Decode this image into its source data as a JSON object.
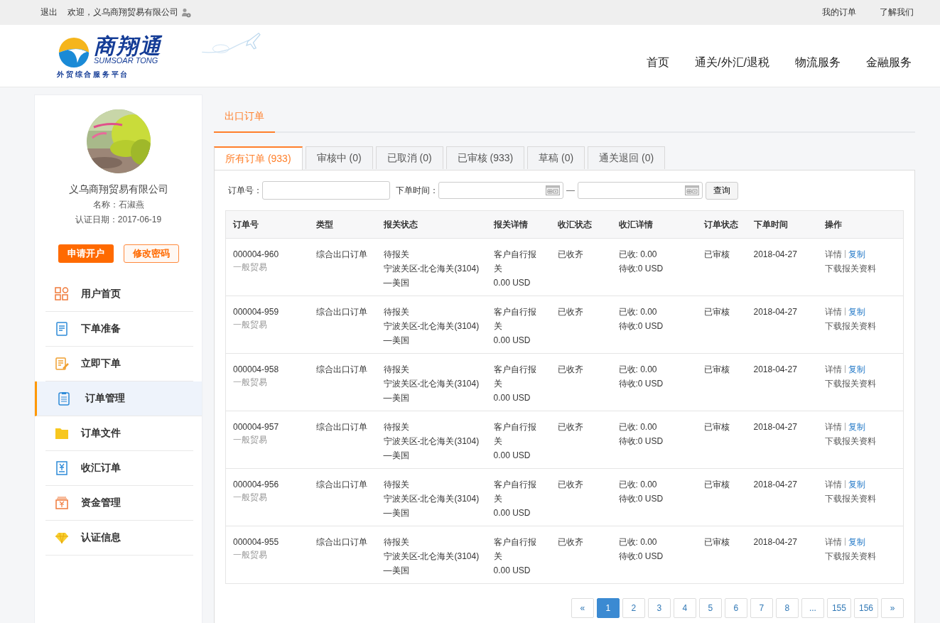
{
  "top_bar": {
    "logout": "退出",
    "welcome": "欢迎，义乌商翔贸易有限公司",
    "links": [
      "我的订单",
      "了解我们"
    ]
  },
  "header": {
    "logo": {
      "name": "商翔通",
      "latin": "SUMSOAR TONG",
      "tagline": "外 贸 综 合 服 务 平 台"
    },
    "nav": [
      "首页",
      "通关/外汇/退税",
      "物流服务",
      "金融服务"
    ]
  },
  "profile": {
    "company": "义乌商翔贸易有限公司",
    "contact": "名称：石淑燕",
    "cert_date": "认证日期：2017-06-19",
    "buttons": [
      "申请开户",
      "修改密码"
    ]
  },
  "sidebar": {
    "items": [
      {
        "label": "用户首页",
        "kind": "grid",
        "selected": false
      },
      {
        "label": "下单准备",
        "kind": "doc",
        "selected": false
      },
      {
        "label": "立即下单",
        "kind": "edit",
        "selected": false
      },
      {
        "label": "订单管理",
        "kind": "clipboard",
        "selected": true
      },
      {
        "label": "订单文件",
        "kind": "folder",
        "selected": false
      },
      {
        "label": "收汇订单",
        "kind": "receipt",
        "selected": false
      },
      {
        "label": "资金管理",
        "kind": "money",
        "selected": false
      },
      {
        "label": "认证信息",
        "kind": "diamond",
        "selected": false
      }
    ]
  },
  "page_tab": "出口订单",
  "tabs": [
    {
      "label": "所有订单 (933)",
      "selected": true
    },
    {
      "label": "审核中 (0)",
      "selected": false
    },
    {
      "label": "已取消 (0)",
      "selected": false
    },
    {
      "label": "已审核 (933)",
      "selected": false
    },
    {
      "label": "草稿 (0)",
      "selected": false
    },
    {
      "label": "通关退回 (0)",
      "selected": false
    }
  ],
  "filters": {
    "order_label": "订单号：",
    "time_label": "下单时间：",
    "separator": "—",
    "query_button": "查询"
  },
  "table": {
    "columns": [
      "订单号",
      "类型",
      "报关状态",
      "报关详情",
      "收汇状态",
      "收汇详情",
      "订单状态",
      "下单时间",
      "操作"
    ],
    "rows": [
      {
        "order_no": "000004-960",
        "trade": "一般贸易",
        "type": "综合出口订单",
        "customs_status": "待报关",
        "route": "宁波关区-北仑海关(3104)",
        "dest": "—美国",
        "customs_detail": "客户自行报关",
        "amount": "0.00 USD",
        "fx_status": "已收齐",
        "received": "已收: 0.00",
        "pending": "待收:0 USD",
        "status": "已审核",
        "date": "2018-04-27",
        "actions": [
          "详情",
          "复制",
          "下载报关资料"
        ]
      },
      {
        "order_no": "000004-959",
        "trade": "一般贸易",
        "type": "综合出口订单",
        "customs_status": "待报关",
        "route": "宁波关区-北仑海关(3104)",
        "dest": "—美国",
        "customs_detail": "客户自行报关",
        "amount": "0.00 USD",
        "fx_status": "已收齐",
        "received": "已收: 0.00",
        "pending": "待收:0 USD",
        "status": "已审核",
        "date": "2018-04-27",
        "actions": [
          "详情",
          "复制",
          "下载报关资料"
        ]
      },
      {
        "order_no": "000004-958",
        "trade": "一般贸易",
        "type": "综合出口订单",
        "customs_status": "待报关",
        "route": "宁波关区-北仑海关(3104)",
        "dest": "—美国",
        "customs_detail": "客户自行报关",
        "amount": "0.00 USD",
        "fx_status": "已收齐",
        "received": "已收: 0.00",
        "pending": "待收:0 USD",
        "status": "已审核",
        "date": "2018-04-27",
        "actions": [
          "详情",
          "复制",
          "下载报关资料"
        ]
      },
      {
        "order_no": "000004-957",
        "trade": "一般贸易",
        "type": "综合出口订单",
        "customs_status": "待报关",
        "route": "宁波关区-北仑海关(3104)",
        "dest": "—美国",
        "customs_detail": "客户自行报关",
        "amount": "0.00 USD",
        "fx_status": "已收齐",
        "received": "已收: 0.00",
        "pending": "待收:0 USD",
        "status": "已审核",
        "date": "2018-04-27",
        "actions": [
          "详情",
          "复制",
          "下载报关资料"
        ]
      },
      {
        "order_no": "000004-956",
        "trade": "一般贸易",
        "type": "综合出口订单",
        "customs_status": "待报关",
        "route": "宁波关区-北仑海关(3104)",
        "dest": "—美国",
        "customs_detail": "客户自行报关",
        "amount": "0.00 USD",
        "fx_status": "已收齐",
        "received": "已收: 0.00",
        "pending": "待收:0 USD",
        "status": "已审核",
        "date": "2018-04-27",
        "actions": [
          "详情",
          "复制",
          "下载报关资料"
        ]
      },
      {
        "order_no": "000004-955",
        "trade": "一般贸易",
        "type": "综合出口订单",
        "customs_status": "待报关",
        "route": "宁波关区-北仑海关(3104)",
        "dest": "—美国",
        "customs_detail": "客户自行报关",
        "amount": "0.00 USD",
        "fx_status": "已收齐",
        "received": "已收: 0.00",
        "pending": "待收:0 USD",
        "status": "已审核",
        "date": "2018-04-27",
        "actions": [
          "详情",
          "复制",
          "下载报关资料"
        ]
      }
    ]
  },
  "pagination": [
    {
      "label": "«",
      "selected": false
    },
    {
      "label": "1",
      "selected": true
    },
    {
      "label": "2",
      "selected": false
    },
    {
      "label": "3",
      "selected": false
    },
    {
      "label": "4",
      "selected": false
    },
    {
      "label": "5",
      "selected": false
    },
    {
      "label": "6",
      "selected": false
    },
    {
      "label": "7",
      "selected": false
    },
    {
      "label": "8",
      "selected": false
    },
    {
      "label": "...",
      "selected": false
    },
    {
      "label": "155",
      "selected": false
    },
    {
      "label": "156",
      "selected": false
    },
    {
      "label": "»",
      "selected": false
    }
  ]
}
